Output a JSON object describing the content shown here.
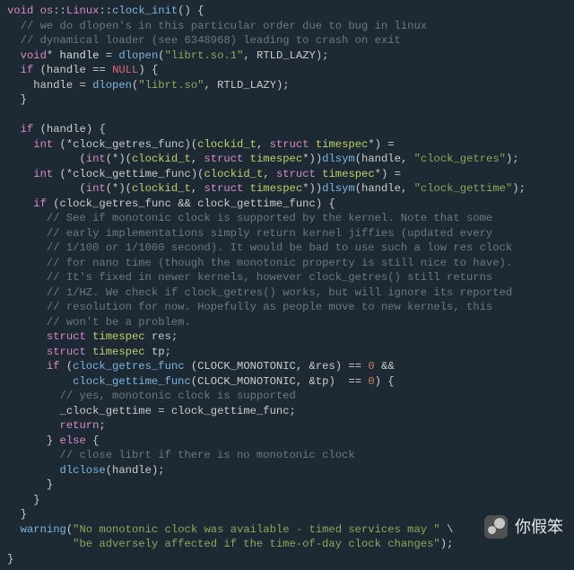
{
  "sig": {
    "kw_void": "void",
    "ns": "os",
    "cls": "Linux",
    "fn": "clock_init"
  },
  "c1": "// we do dlopen's in this particular order due to bug in linux",
  "c2": "// dynamical loader (see 6348968) leading to crash on exit",
  "l3": {
    "kw_void": "void",
    "var": "handle",
    "fn": "dlopen",
    "s": "\"librt.so.1\"",
    "arg": "RTLD_LAZY"
  },
  "l4": {
    "kw_if": "if",
    "var": "handle",
    "null": "NULL"
  },
  "l5": {
    "var": "handle",
    "fn": "dlopen",
    "s": "\"librt.so\"",
    "arg": "RTLD_LAZY"
  },
  "rb1": "}",
  "l7": {
    "kw_if": "if",
    "var": "handle"
  },
  "l8": {
    "kw_int": "int",
    "var": "clock_getres_func",
    "t1": "clockid_t",
    "kw_struct": "struct",
    "t2": "timespec"
  },
  "l9": {
    "kw_int": "int",
    "t1": "clockid_t",
    "kw_struct": "struct",
    "t2": "timespec",
    "fn": "dlsym",
    "var": "handle",
    "s": "\"clock_getres\""
  },
  "l10": {
    "kw_int": "int",
    "var": "clock_gettime_func",
    "t1": "clockid_t",
    "kw_struct": "struct",
    "t2": "timespec"
  },
  "l11": {
    "kw_int": "int",
    "t1": "clockid_t",
    "kw_struct": "struct",
    "t2": "timespec",
    "fn": "dlsym",
    "var": "handle",
    "s": "\"clock_gettime\""
  },
  "l12": {
    "kw_if": "if",
    "a": "clock_getres_func",
    "b": "clock_gettime_func"
  },
  "c3": "// See if monotonic clock is supported by the kernel. Note that some",
  "c4": "// early implementations simply return kernel jiffies (updated every",
  "c5": "// 1/100 or 1/1000 second). It would be bad to use such a low res clock",
  "c6": "// for nano time (though the monotonic property is still nice to have).",
  "c7": "// It's fixed in newer kernels, however clock_getres() still returns",
  "c8": "// 1/HZ. We check if clock_getres() works, but will ignore its reported",
  "c9": "// resolution for now. Hopefully as people move to new kernels, this",
  "c10": "// won't be a problem.",
  "l13": {
    "kw_struct": "struct",
    "t": "timespec",
    "v": "res"
  },
  "l14": {
    "kw_struct": "struct",
    "t": "timespec",
    "v": "tp"
  },
  "l15": {
    "kw_if": "if",
    "f1": "clock_getres_func",
    "m": "CLOCK_MONOTONIC",
    "a1": "&res",
    "z": "0",
    "amp": "&&"
  },
  "l16": {
    "f2": "clock_gettime_func",
    "m": "CLOCK_MONOTONIC",
    "a2": "&tp",
    "z": "0"
  },
  "c11": "// yes, monotonic clock is supported",
  "l17": {
    "lhs": "_clock_gettime",
    "rhs": "clock_gettime_func"
  },
  "l18": {
    "kw": "return"
  },
  "rb2": "}",
  "kw_else": "else",
  "c12": "// close librt if there is no monotonic clock",
  "l19": {
    "fn": "dlclose",
    "var": "handle"
  },
  "rb3": "}",
  "rb4": "}",
  "rb5": "}",
  "l20": {
    "fn": "warning",
    "s1": "\"No monotonic clock was available - timed services may \"",
    "bs": "\\"
  },
  "l21": {
    "s2": "\"be adversely affected if the time-of-day clock changes\""
  },
  "rb6": "}",
  "watermark": "你假笨"
}
